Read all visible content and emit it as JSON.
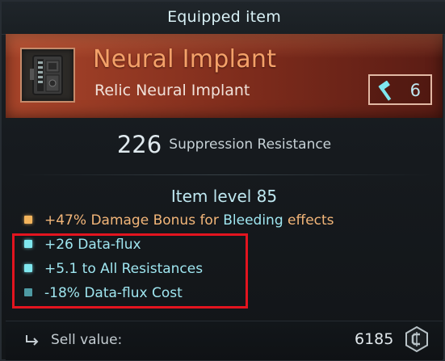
{
  "title": "Equipped item",
  "item": {
    "name": "Neural Implant",
    "type": "Relic Neural Implant",
    "icon": "neural-implant-icon",
    "crafting": {
      "icon": "hammer-icon",
      "value": "6"
    }
  },
  "primary_stat": {
    "value": "226",
    "label": "Suppression Resistance"
  },
  "item_level": "Item level 85",
  "stats": [
    {
      "bullet": "orange",
      "parts": [
        "+47% ",
        "Damage Bonus for ",
        "Bleeding",
        " effects"
      ]
    },
    {
      "bullet": "cyan",
      "text": "+26 Data-flux"
    },
    {
      "bullet": "cyan",
      "text": "+5.1 to All Resistances"
    },
    {
      "bullet": "dimcyan",
      "text": "-18% Data-flux Cost"
    }
  ],
  "footer": {
    "sell_label": "Sell value:",
    "sell_value": "6185",
    "currency_icon": "credits-icon"
  },
  "colors": {
    "rarity": "#f4a169",
    "header_bg": "#a9452a",
    "accent": "#9fe6f0",
    "highlight_box": "#e3141f"
  }
}
